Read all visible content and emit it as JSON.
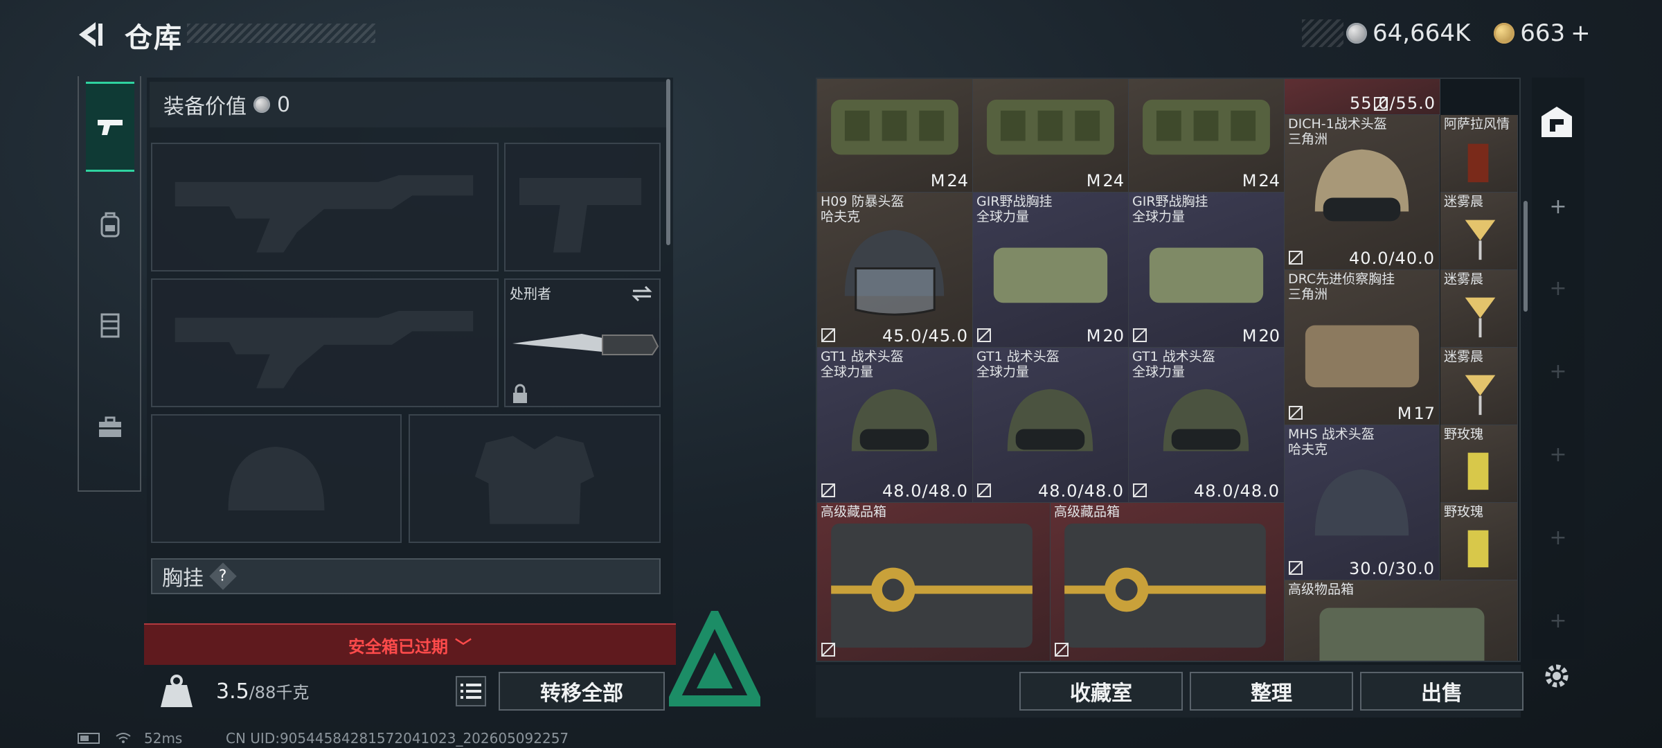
{
  "header": {
    "title": "仓库"
  },
  "currency": {
    "silver": "64,664K",
    "gold": "663",
    "gold_plus": "+"
  },
  "loadout": {
    "equip_value_label": "装备价值",
    "equip_value": "0",
    "knife_name": "处刑者",
    "rig_label": "胸挂",
    "rig_help": "?"
  },
  "safe_box": {
    "text": "安全箱已过期",
    "chevron": "﹀"
  },
  "capacity": {
    "value": "3.5",
    "max": "/88千克"
  },
  "actions": {
    "transfer_all": "转移全部",
    "collection": "收藏室",
    "sort": "整理",
    "sell": "出售"
  },
  "status": {
    "ping": "52ms",
    "uid": "CN UID:905445842815720410​23_202605092257"
  },
  "storage": {
    "items": [
      {
        "name": "",
        "sub": "",
        "value": "24"
      },
      {
        "name": "",
        "sub": "",
        "value": "24"
      },
      {
        "name": "",
        "sub": "",
        "value": "24"
      },
      {
        "name": "",
        "sub": "",
        "value": "55.0/55.0"
      },
      {
        "name": "DICH-1战术头盔",
        "sub": "三角洲",
        "value": "40.0/40.0"
      },
      {
        "name": "阿萨拉风情",
        "sub": "",
        "value": ""
      },
      {
        "name": "H09 防暴头盔",
        "sub": "哈夫克",
        "value": "45.0/45.0"
      },
      {
        "name": "GIR野战胸挂",
        "sub": "全球力量",
        "value": "20"
      },
      {
        "name": "GIR野战胸挂",
        "sub": "全球力量",
        "value": "20"
      },
      {
        "name": "迷雾晨",
        "sub": "",
        "value": ""
      },
      {
        "name": "DRC先进侦察胸挂",
        "sub": "三角洲",
        "value": "17"
      },
      {
        "name": "迷雾晨",
        "sub": "",
        "value": ""
      },
      {
        "name": "GT1 战术头盔",
        "sub": "全球力量",
        "value": "48.0/48.0"
      },
      {
        "name": "GT1 战术头盔",
        "sub": "全球力量",
        "value": "48.0/48.0"
      },
      {
        "name": "GT1 战术头盔",
        "sub": "全球力量",
        "value": "48.0/48.0"
      },
      {
        "name": "迷雾晨",
        "sub": "",
        "value": ""
      },
      {
        "name": "MHS 战术头盔",
        "sub": "哈夫克",
        "value": "30.0/30.0"
      },
      {
        "name": "野玫瑰",
        "sub": "",
        "value": ""
      },
      {
        "name": "野玫瑰",
        "sub": "",
        "value": ""
      },
      {
        "name": "高级藏品箱",
        "sub": "",
        "value": ""
      },
      {
        "name": "高级藏品箱",
        "sub": "",
        "value": ""
      },
      {
        "name": "高级物品箱",
        "sub": "",
        "value": ""
      }
    ]
  },
  "colors": {
    "accent": "#2fd3a0",
    "danger": "#ff4b4b",
    "safe_bg": "#5f1a1e"
  },
  "icons": [
    "back-arrow-icon",
    "pistol-icon",
    "backpack-icon",
    "vest-icon",
    "toolbox-icon",
    "silver-coin-icon",
    "gold-coin-icon",
    "swap-icon",
    "lock-icon",
    "weight-icon",
    "list-icon",
    "no-insure-icon",
    "weight-count-icon",
    "storage-room-icon",
    "plus-icon",
    "settings-icon",
    "battery-icon",
    "wifi-icon"
  ]
}
